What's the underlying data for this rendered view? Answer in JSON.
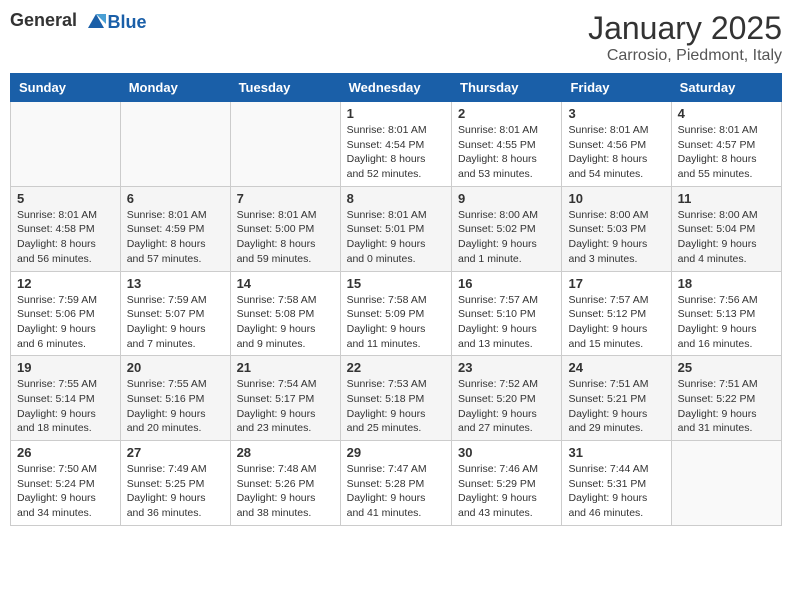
{
  "logo": {
    "general": "General",
    "blue": "Blue"
  },
  "header": {
    "month": "January 2025",
    "location": "Carrosio, Piedmont, Italy"
  },
  "weekdays": [
    "Sunday",
    "Monday",
    "Tuesday",
    "Wednesday",
    "Thursday",
    "Friday",
    "Saturday"
  ],
  "weeks": [
    [
      {
        "day": "",
        "info": ""
      },
      {
        "day": "",
        "info": ""
      },
      {
        "day": "",
        "info": ""
      },
      {
        "day": "1",
        "info": "Sunrise: 8:01 AM\nSunset: 4:54 PM\nDaylight: 8 hours\nand 52 minutes."
      },
      {
        "day": "2",
        "info": "Sunrise: 8:01 AM\nSunset: 4:55 PM\nDaylight: 8 hours\nand 53 minutes."
      },
      {
        "day": "3",
        "info": "Sunrise: 8:01 AM\nSunset: 4:56 PM\nDaylight: 8 hours\nand 54 minutes."
      },
      {
        "day": "4",
        "info": "Sunrise: 8:01 AM\nSunset: 4:57 PM\nDaylight: 8 hours\nand 55 minutes."
      }
    ],
    [
      {
        "day": "5",
        "info": "Sunrise: 8:01 AM\nSunset: 4:58 PM\nDaylight: 8 hours\nand 56 minutes."
      },
      {
        "day": "6",
        "info": "Sunrise: 8:01 AM\nSunset: 4:59 PM\nDaylight: 8 hours\nand 57 minutes."
      },
      {
        "day": "7",
        "info": "Sunrise: 8:01 AM\nSunset: 5:00 PM\nDaylight: 8 hours\nand 59 minutes."
      },
      {
        "day": "8",
        "info": "Sunrise: 8:01 AM\nSunset: 5:01 PM\nDaylight: 9 hours\nand 0 minutes."
      },
      {
        "day": "9",
        "info": "Sunrise: 8:00 AM\nSunset: 5:02 PM\nDaylight: 9 hours\nand 1 minute."
      },
      {
        "day": "10",
        "info": "Sunrise: 8:00 AM\nSunset: 5:03 PM\nDaylight: 9 hours\nand 3 minutes."
      },
      {
        "day": "11",
        "info": "Sunrise: 8:00 AM\nSunset: 5:04 PM\nDaylight: 9 hours\nand 4 minutes."
      }
    ],
    [
      {
        "day": "12",
        "info": "Sunrise: 7:59 AM\nSunset: 5:06 PM\nDaylight: 9 hours\nand 6 minutes."
      },
      {
        "day": "13",
        "info": "Sunrise: 7:59 AM\nSunset: 5:07 PM\nDaylight: 9 hours\nand 7 minutes."
      },
      {
        "day": "14",
        "info": "Sunrise: 7:58 AM\nSunset: 5:08 PM\nDaylight: 9 hours\nand 9 minutes."
      },
      {
        "day": "15",
        "info": "Sunrise: 7:58 AM\nSunset: 5:09 PM\nDaylight: 9 hours\nand 11 minutes."
      },
      {
        "day": "16",
        "info": "Sunrise: 7:57 AM\nSunset: 5:10 PM\nDaylight: 9 hours\nand 13 minutes."
      },
      {
        "day": "17",
        "info": "Sunrise: 7:57 AM\nSunset: 5:12 PM\nDaylight: 9 hours\nand 15 minutes."
      },
      {
        "day": "18",
        "info": "Sunrise: 7:56 AM\nSunset: 5:13 PM\nDaylight: 9 hours\nand 16 minutes."
      }
    ],
    [
      {
        "day": "19",
        "info": "Sunrise: 7:55 AM\nSunset: 5:14 PM\nDaylight: 9 hours\nand 18 minutes."
      },
      {
        "day": "20",
        "info": "Sunrise: 7:55 AM\nSunset: 5:16 PM\nDaylight: 9 hours\nand 20 minutes."
      },
      {
        "day": "21",
        "info": "Sunrise: 7:54 AM\nSunset: 5:17 PM\nDaylight: 9 hours\nand 23 minutes."
      },
      {
        "day": "22",
        "info": "Sunrise: 7:53 AM\nSunset: 5:18 PM\nDaylight: 9 hours\nand 25 minutes."
      },
      {
        "day": "23",
        "info": "Sunrise: 7:52 AM\nSunset: 5:20 PM\nDaylight: 9 hours\nand 27 minutes."
      },
      {
        "day": "24",
        "info": "Sunrise: 7:51 AM\nSunset: 5:21 PM\nDaylight: 9 hours\nand 29 minutes."
      },
      {
        "day": "25",
        "info": "Sunrise: 7:51 AM\nSunset: 5:22 PM\nDaylight: 9 hours\nand 31 minutes."
      }
    ],
    [
      {
        "day": "26",
        "info": "Sunrise: 7:50 AM\nSunset: 5:24 PM\nDaylight: 9 hours\nand 34 minutes."
      },
      {
        "day": "27",
        "info": "Sunrise: 7:49 AM\nSunset: 5:25 PM\nDaylight: 9 hours\nand 36 minutes."
      },
      {
        "day": "28",
        "info": "Sunrise: 7:48 AM\nSunset: 5:26 PM\nDaylight: 9 hours\nand 38 minutes."
      },
      {
        "day": "29",
        "info": "Sunrise: 7:47 AM\nSunset: 5:28 PM\nDaylight: 9 hours\nand 41 minutes."
      },
      {
        "day": "30",
        "info": "Sunrise: 7:46 AM\nSunset: 5:29 PM\nDaylight: 9 hours\nand 43 minutes."
      },
      {
        "day": "31",
        "info": "Sunrise: 7:44 AM\nSunset: 5:31 PM\nDaylight: 9 hours\nand 46 minutes."
      },
      {
        "day": "",
        "info": ""
      }
    ]
  ]
}
